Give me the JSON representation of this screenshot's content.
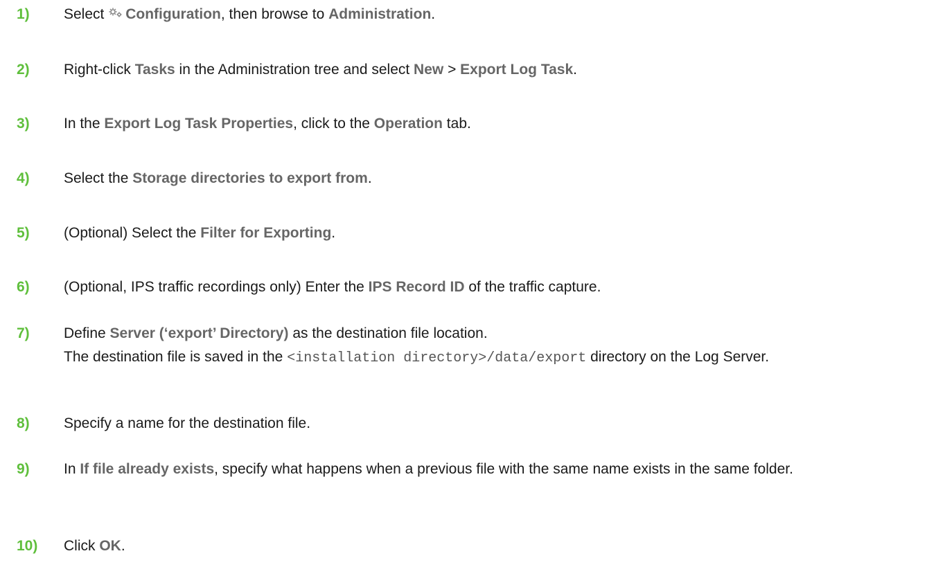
{
  "steps": [
    {
      "num": "1)",
      "parts": [
        "Select",
        "Configuration",
        ", then browse to ",
        "Administration",
        "."
      ]
    },
    {
      "num": "2)",
      "parts": [
        "Right-click ",
        "Tasks",
        " in the Administration tree and select ",
        "New",
        " > ",
        "Export Log Task",
        "."
      ]
    },
    {
      "num": "3)",
      "parts": [
        "In the ",
        "Export Log Task Properties",
        ", click to the ",
        "Operation",
        " tab."
      ]
    },
    {
      "num": "4)",
      "parts": [
        "Select the ",
        "Storage directories to export from",
        "."
      ]
    },
    {
      "num": "5)",
      "parts": [
        "(Optional) Select the ",
        "Filter for Exporting",
        "."
      ]
    },
    {
      "num": "6)",
      "parts": [
        "(Optional, IPS traffic recordings only) Enter the ",
        "IPS Record ID",
        " of the traffic capture."
      ]
    },
    {
      "num": "7)",
      "parts": [
        "Define ",
        "Server (‘export’ Directory)",
        " as the destination file location."
      ],
      "note": [
        "The destination file is saved in the ",
        "<installation directory>/data/export",
        " directory on the Log Server."
      ]
    },
    {
      "num": "8)",
      "parts": [
        "Specify a name for the destination file."
      ]
    },
    {
      "num": "9)",
      "parts": [
        "In ",
        "If file already exists",
        ", specify what happens when a previous file with the same name exists in the same folder."
      ]
    },
    {
      "num": "10)",
      "parts": [
        "Click ",
        "OK",
        "."
      ]
    }
  ],
  "icons": {
    "gear": "gears-icon"
  },
  "colors": {
    "step_number": "#5fbf3c",
    "ui_label": "#666666",
    "body_text": "#1a1a1a"
  }
}
